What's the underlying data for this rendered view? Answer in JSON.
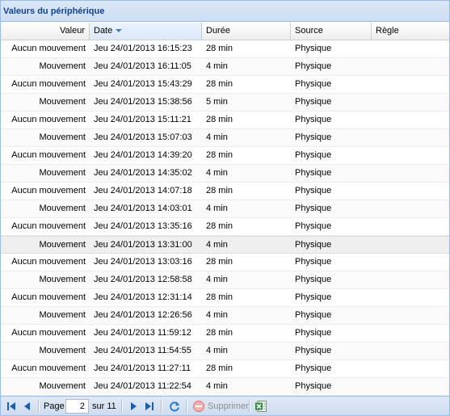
{
  "panel": {
    "title": "Valeurs du périphérique"
  },
  "columns": {
    "valeur": "Valeur",
    "date": "Date",
    "duree": "Durée",
    "source": "Source",
    "regle": "Règle"
  },
  "rows": [
    {
      "valeur": "Aucun mouvement",
      "date": "Jeu 24/01/2013 16:15:23",
      "duree": "28 min",
      "source": "Physique",
      "regle": ""
    },
    {
      "valeur": "Mouvement",
      "date": "Jeu 24/01/2013 16:11:05",
      "duree": "4 min",
      "source": "Physique",
      "regle": ""
    },
    {
      "valeur": "Aucun mouvement",
      "date": "Jeu 24/01/2013 15:43:29",
      "duree": "28 min",
      "source": "Physique",
      "regle": ""
    },
    {
      "valeur": "Mouvement",
      "date": "Jeu 24/01/2013 15:38:56",
      "duree": "5 min",
      "source": "Physique",
      "regle": ""
    },
    {
      "valeur": "Aucun mouvement",
      "date": "Jeu 24/01/2013 15:11:21",
      "duree": "28 min",
      "source": "Physique",
      "regle": ""
    },
    {
      "valeur": "Mouvement",
      "date": "Jeu 24/01/2013 15:07:03",
      "duree": "4 min",
      "source": "Physique",
      "regle": ""
    },
    {
      "valeur": "Aucun mouvement",
      "date": "Jeu 24/01/2013 14:39:20",
      "duree": "28 min",
      "source": "Physique",
      "regle": ""
    },
    {
      "valeur": "Mouvement",
      "date": "Jeu 24/01/2013 14:35:02",
      "duree": "4 min",
      "source": "Physique",
      "regle": ""
    },
    {
      "valeur": "Aucun mouvement",
      "date": "Jeu 24/01/2013 14:07:18",
      "duree": "28 min",
      "source": "Physique",
      "regle": ""
    },
    {
      "valeur": "Mouvement",
      "date": "Jeu 24/01/2013 14:03:01",
      "duree": "4 min",
      "source": "Physique",
      "regle": ""
    },
    {
      "valeur": "Aucun mouvement",
      "date": "Jeu 24/01/2013 13:35:16",
      "duree": "28 min",
      "source": "Physique",
      "regle": ""
    },
    {
      "valeur": "Mouvement",
      "date": "Jeu 24/01/2013 13:31:00",
      "duree": "4 min",
      "source": "Physique",
      "regle": ""
    },
    {
      "valeur": "Aucun mouvement",
      "date": "Jeu 24/01/2013 13:03:16",
      "duree": "28 min",
      "source": "Physique",
      "regle": ""
    },
    {
      "valeur": "Mouvement",
      "date": "Jeu 24/01/2013 12:58:58",
      "duree": "4 min",
      "source": "Physique",
      "regle": ""
    },
    {
      "valeur": "Aucun mouvement",
      "date": "Jeu 24/01/2013 12:31:14",
      "duree": "28 min",
      "source": "Physique",
      "regle": ""
    },
    {
      "valeur": "Mouvement",
      "date": "Jeu 24/01/2013 12:26:56",
      "duree": "4 min",
      "source": "Physique",
      "regle": ""
    },
    {
      "valeur": "Aucun mouvement",
      "date": "Jeu 24/01/2013 11:59:12",
      "duree": "28 min",
      "source": "Physique",
      "regle": ""
    },
    {
      "valeur": "Mouvement",
      "date": "Jeu 24/01/2013 11:54:55",
      "duree": "4 min",
      "source": "Physique",
      "regle": ""
    },
    {
      "valeur": "Aucun mouvement",
      "date": "Jeu 24/01/2013 11:27:11",
      "duree": "28 min",
      "source": "Physique",
      "regle": ""
    },
    {
      "valeur": "Mouvement",
      "date": "Jeu 24/01/2013 11:22:54",
      "duree": "4 min",
      "source": "Physique",
      "regle": ""
    }
  ],
  "paging": {
    "page_label": "Page",
    "current_page": "2",
    "of_label": "sur 11",
    "delete_label": "Supprimer"
  },
  "colors": {
    "accent": "#15428b",
    "border": "#99bbe8",
    "refresh": "#2f7dc5",
    "delete": "#e04848",
    "excel": "#2e8b3a"
  },
  "icons": [
    "first-page-icon",
    "prev-page-icon",
    "next-page-icon",
    "last-page-icon",
    "refresh-icon",
    "delete-icon",
    "excel-export-icon"
  ]
}
